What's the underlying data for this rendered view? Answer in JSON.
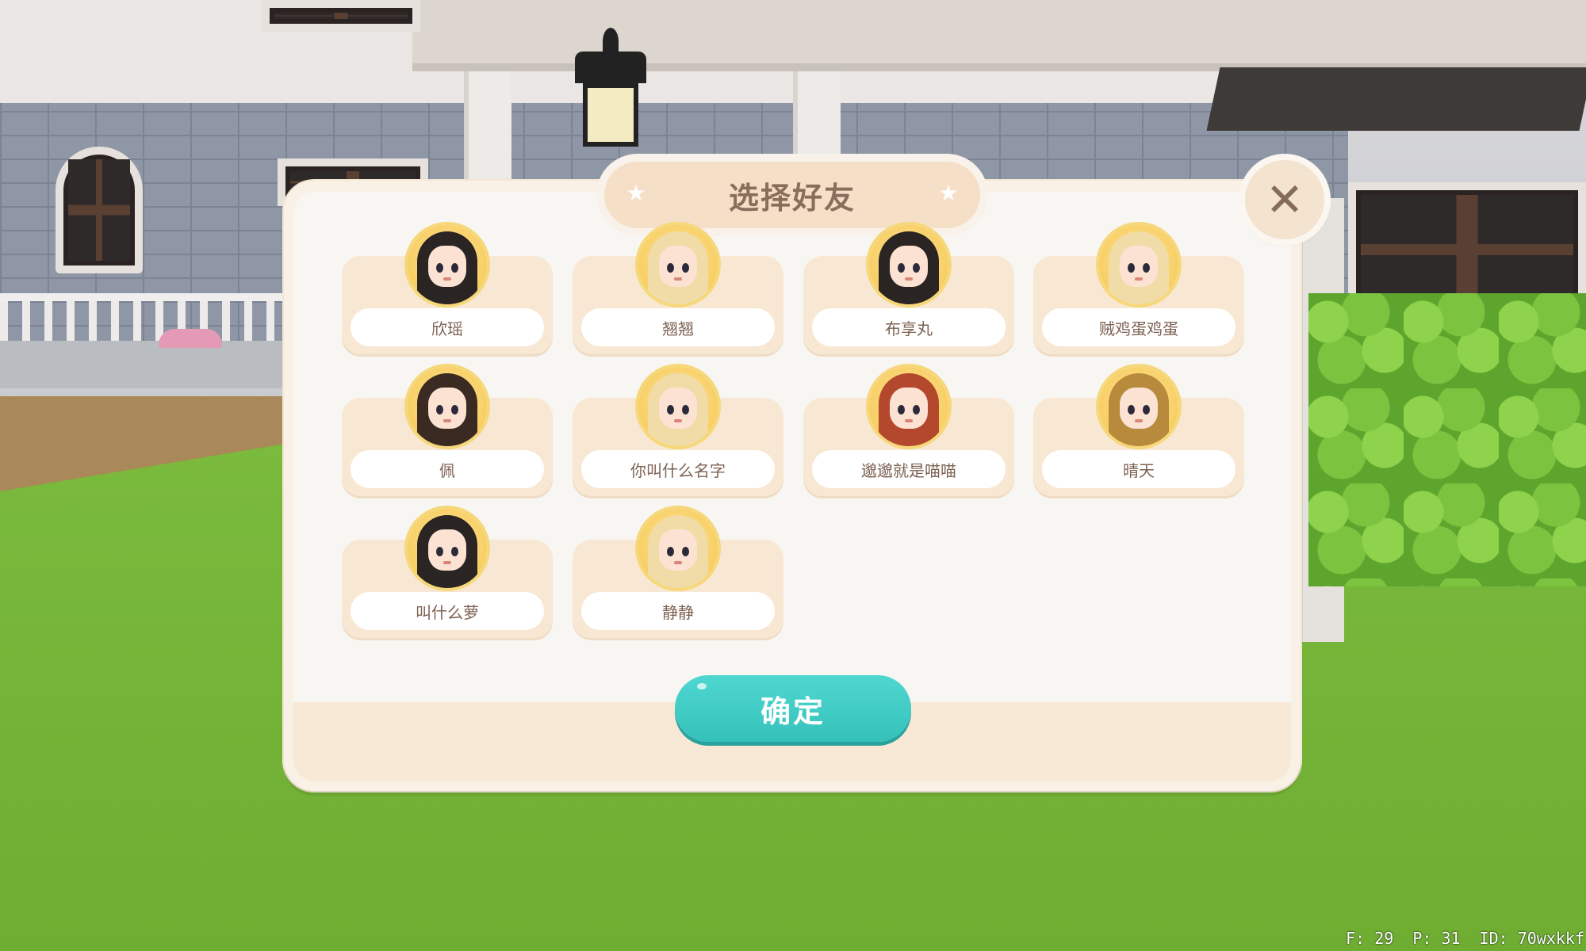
{
  "dialog": {
    "title": "选择好友",
    "close_icon": "close-icon",
    "confirm_label": "确定",
    "friends": [
      {
        "name": "欣瑶",
        "hair": "black"
      },
      {
        "name": "翘翘",
        "hair": "blonde"
      },
      {
        "name": "布享丸",
        "hair": "black"
      },
      {
        "name": "贼鸡蛋鸡蛋",
        "hair": "blonde"
      },
      {
        "name": "佩",
        "hair": "brown"
      },
      {
        "name": "你叫什么名字",
        "hair": "blonde"
      },
      {
        "name": "邈邈就是喵喵",
        "hair": "red"
      },
      {
        "name": "晴天",
        "hair": "gold"
      },
      {
        "name": "叫什么萝",
        "hair": "black"
      },
      {
        "name": "静静",
        "hair": "blonde"
      }
    ]
  },
  "status": {
    "fps": "F: 29",
    "ping": "P: 31",
    "id": "ID: 70wxkkf"
  },
  "colors": {
    "confirm": "#3ccac3",
    "title_text": "#8a6e5d",
    "card": "#f8e8d3"
  }
}
